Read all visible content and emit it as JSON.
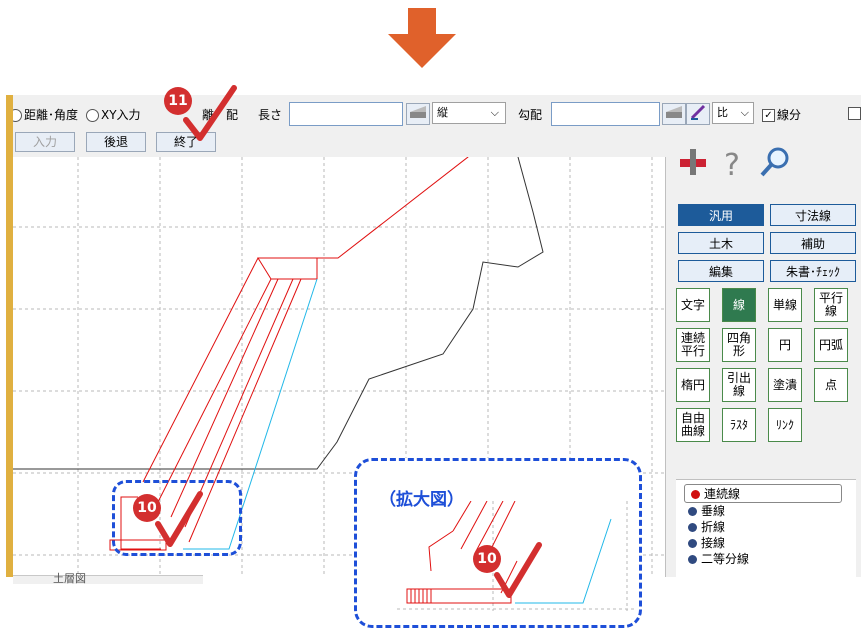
{
  "toolbar": {
    "radio_distance_angle": "距離･角度",
    "radio_xy": "XY入力",
    "partial_label": "離　配",
    "length_label": "長さ",
    "length_value": "",
    "orientation_value": "縦",
    "slope_label": "勾配",
    "slope_value": "",
    "ratio_value": "比",
    "segment_label": "線分",
    "input_button": "入力",
    "back_button": "後退",
    "end_button": "終了"
  },
  "panel": {
    "categories": [
      "汎用",
      "寸法線",
      "土木",
      "補助",
      "編集",
      "朱書･ﾁｪｯｸ"
    ],
    "tools": [
      "文字",
      "線",
      "単線",
      "平行線",
      "連続平行",
      "四角形",
      "円",
      "円弧",
      "楕円",
      "引出線",
      "塗潰",
      "点",
      "自由曲線",
      "ﾗｽﾀ",
      "ﾘﾝｸ"
    ],
    "sub_items": [
      "連続線",
      "垂線",
      "折線",
      "接線",
      "二等分線"
    ]
  },
  "annotations": {
    "zoom_label": "（拡大図）",
    "step_10": "10",
    "step_11": "11"
  },
  "bottom_tab": "土層図",
  "colors": {
    "arrow": "#e0612b",
    "badge": "#d32f2f",
    "callout_border": "#1e4fd8",
    "selected_category": "#1d5b9a",
    "selected_tool": "#2f7a4f"
  }
}
